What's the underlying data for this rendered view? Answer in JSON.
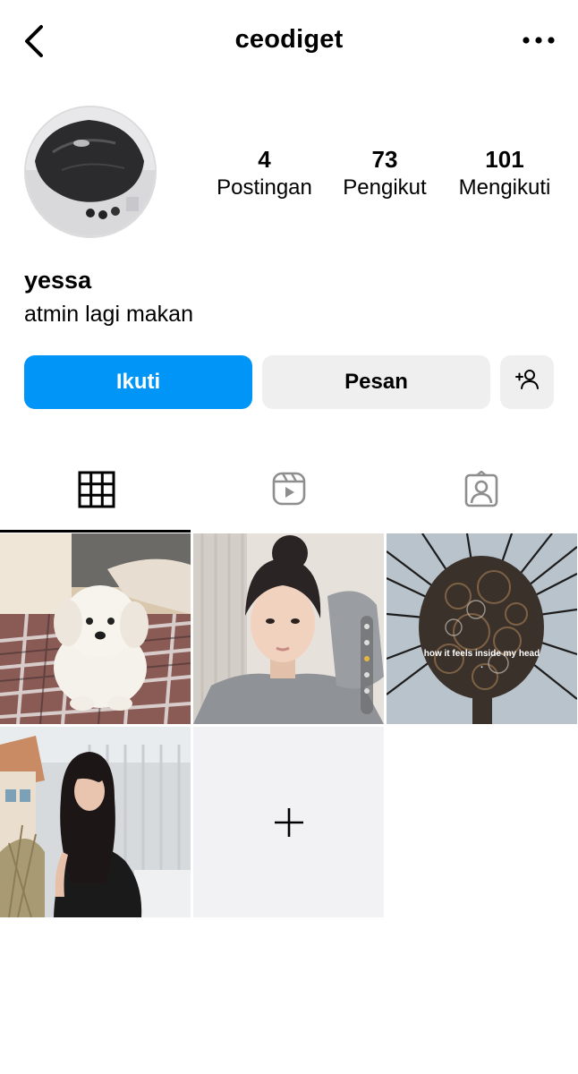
{
  "header": {
    "username": "ceodiget"
  },
  "profile": {
    "stats": [
      {
        "value": "4",
        "label": "Postingan"
      },
      {
        "value": "73",
        "label": "Pengikut"
      },
      {
        "value": "101",
        "label": "Mengikuti"
      }
    ],
    "name": "yessa",
    "bio": "atmin lagi makan"
  },
  "actions": {
    "follow_label": "Ikuti",
    "message_label": "Pesan"
  },
  "tabs": [
    {
      "icon": "grid-icon",
      "active": true
    },
    {
      "icon": "reels-icon",
      "active": false
    },
    {
      "icon": "tagged-icon",
      "active": false
    }
  ],
  "posts": [
    {
      "subject": "white-puppy-photo"
    },
    {
      "subject": "girl-selfie-photo"
    },
    {
      "subject": "tangled-wires-head-photo",
      "caption": "how it feels inside my head ."
    },
    {
      "subject": "girl-balcony-photo"
    }
  ],
  "colors": {
    "accent": "#0095f6",
    "button_gray": "#efefef",
    "add_tile": "#f2f2f5"
  }
}
